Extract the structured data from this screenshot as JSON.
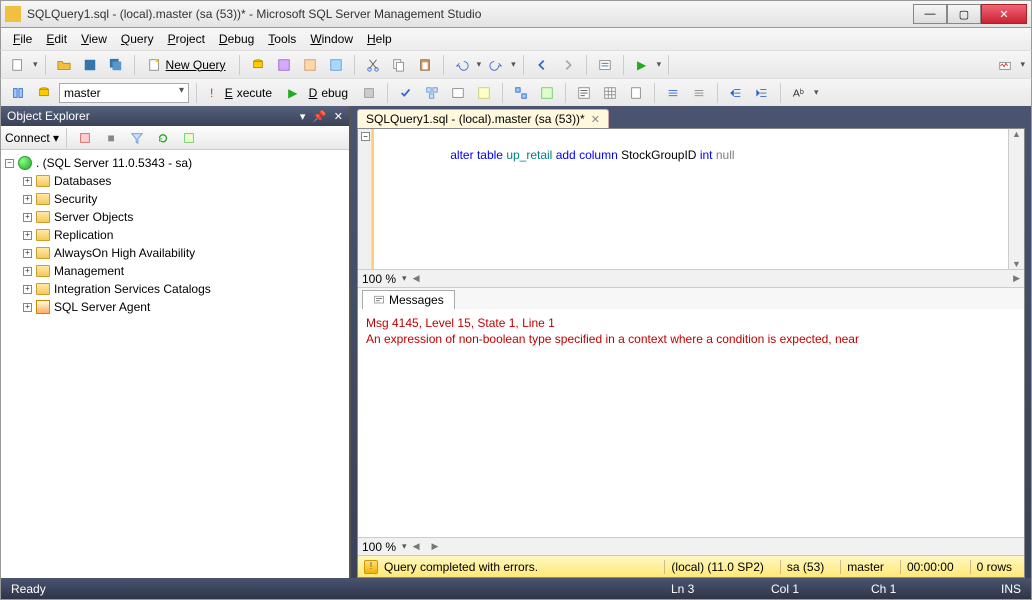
{
  "window": {
    "title": "SQLQuery1.sql - (local).master (sa (53))* - Microsoft SQL Server Management Studio"
  },
  "menubar": [
    "File",
    "Edit",
    "View",
    "Query",
    "Project",
    "Debug",
    "Tools",
    "Window",
    "Help"
  ],
  "toolbar1": {
    "new_query": "New Query",
    "database_combo": "master",
    "execute": "Execute",
    "debug": "Debug"
  },
  "object_explorer": {
    "title": "Object Explorer",
    "connect_label": "Connect",
    "root": ". (SQL Server 11.0.5343 - sa)",
    "nodes": [
      {
        "label": "Databases"
      },
      {
        "label": "Security"
      },
      {
        "label": "Server Objects"
      },
      {
        "label": "Replication"
      },
      {
        "label": "AlwaysOn High Availability"
      },
      {
        "label": "Management"
      },
      {
        "label": "Integration Services Catalogs"
      },
      {
        "label": "SQL Server Agent"
      }
    ]
  },
  "tab": {
    "label": "SQLQuery1.sql - (local).master (sa (53))*"
  },
  "code": {
    "tokens": [
      "alter",
      " ",
      "table",
      " ",
      "up_retail",
      " ",
      "add",
      " ",
      "column",
      " ",
      "StockGroupID",
      " ",
      "int",
      " ",
      "null"
    ]
  },
  "zoom": "100 %",
  "results": {
    "tab": "Messages",
    "msg_line1": "Msg 4145, Level 15, State 1, Line 1",
    "msg_line2": "An expression of non-boolean type specified in a context where a condition is expected, near"
  },
  "zoom2": "100 %",
  "query_status": {
    "text": "Query completed with errors.",
    "server": "(local) (11.0 SP2)",
    "login": "sa (53)",
    "db": "master",
    "elapsed": "00:00:00",
    "rows": "0 rows"
  },
  "app_status": {
    "ready": "Ready",
    "ln": "Ln 3",
    "col": "Col 1",
    "ch": "Ch 1",
    "ins": "INS"
  }
}
